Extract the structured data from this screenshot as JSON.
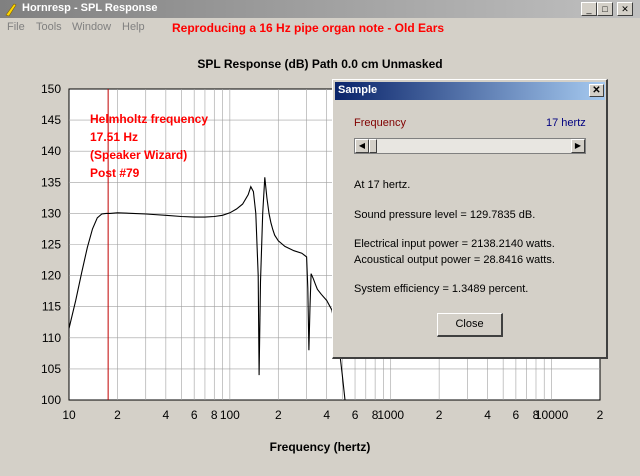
{
  "window": {
    "title": "Hornresp - SPL Response",
    "min_glyph": "_",
    "max_glyph": "□",
    "close_glyph": "✕"
  },
  "menu": {
    "items": [
      "File",
      "Tools",
      "Window",
      "Help"
    ]
  },
  "heading": "Reproducing a 16 Hz pipe organ note - Old Ears",
  "annotation": [
    "Helmholtz frequency",
    "17.51 Hz",
    "(Speaker Wizard)",
    "Post #79"
  ],
  "chart_data": {
    "type": "line",
    "title": "SPL Response (dB)   Path 0.0 cm   Unmasked",
    "xlabel": "Frequency (hertz)",
    "ylabel": "",
    "xscale": "log",
    "xlim": [
      10,
      20000
    ],
    "ylim": [
      100,
      150
    ],
    "y_ticks": [
      100,
      105,
      110,
      115,
      120,
      125,
      130,
      135,
      140,
      145,
      150
    ],
    "x_tick_labels": [
      {
        "x": 10,
        "label": "10"
      },
      {
        "x": 20,
        "label": "2"
      },
      {
        "x": 40,
        "label": "4"
      },
      {
        "x": 60,
        "label": "6"
      },
      {
        "x": 80,
        "label": "8"
      },
      {
        "x": 100,
        "label": "100"
      },
      {
        "x": 200,
        "label": "2"
      },
      {
        "x": 400,
        "label": "4"
      },
      {
        "x": 600,
        "label": "6"
      },
      {
        "x": 800,
        "label": "8"
      },
      {
        "x": 1000,
        "label": "1000"
      },
      {
        "x": 2000,
        "label": "2"
      },
      {
        "x": 4000,
        "label": "4"
      },
      {
        "x": 6000,
        "label": "6"
      },
      {
        "x": 8000,
        "label": "8"
      },
      {
        "x": 10000,
        "label": "10000"
      },
      {
        "x": 20000,
        "label": "2"
      }
    ],
    "grid": true,
    "marker_line": {
      "x": 17.51
    },
    "series": [
      {
        "x": [
          10,
          11,
          12,
          13,
          14,
          15,
          16,
          17,
          18,
          20,
          25,
          30,
          40,
          50,
          60,
          70,
          80,
          90,
          100,
          110,
          120,
          130,
          135,
          140,
          145,
          150,
          152,
          155,
          160,
          165,
          170,
          175,
          180,
          185,
          190,
          200,
          220,
          250,
          280,
          300,
          305,
          310,
          315,
          320,
          330,
          340,
          350,
          370,
          400,
          430,
          450,
          480,
          500,
          520
        ],
        "y": [
          111.5,
          116,
          120.5,
          124.5,
          127.5,
          129.3,
          129.9,
          130.0,
          130.0,
          130.1,
          130.0,
          129.9,
          129.7,
          129.5,
          129.4,
          129.4,
          129.5,
          129.7,
          130.1,
          130.7,
          131.5,
          133.0,
          134.3,
          133.5,
          130.0,
          120.0,
          104.0,
          119.0,
          130.0,
          135.8,
          132.5,
          130.0,
          128.5,
          127.4,
          126.5,
          125.6,
          124.7,
          124.0,
          123.6,
          123.0,
          118.0,
          108.0,
          115.0,
          120.3,
          119.5,
          118.6,
          117.8,
          117.0,
          116.0,
          114.5,
          112.0,
          108.0,
          104.0,
          100.0
        ]
      }
    ]
  },
  "dialog": {
    "title": "Sample",
    "close_glyph": "✕",
    "frequency_label": "Frequency",
    "frequency_value": "17 hertz",
    "slider_fraction": 0.0,
    "slider_left_glyph": "◀",
    "slider_right_glyph": "▶",
    "line_at": "At 17 hertz.",
    "line_spl": "Sound pressure level = 129.7835 dB.",
    "line_electrical": "Electrical input power = 2138.2140 watts.",
    "line_acoustical": "Acoustical output power = 28.8416 watts.",
    "line_efficiency": "System efficiency = 1.3489 percent.",
    "close_button": "Close"
  },
  "colors": {
    "curve": "#000000",
    "marker_line": "#c00000",
    "annotation": "#ff0000",
    "grid": "#a0a0a0",
    "plot_bg": "#ffffff"
  }
}
